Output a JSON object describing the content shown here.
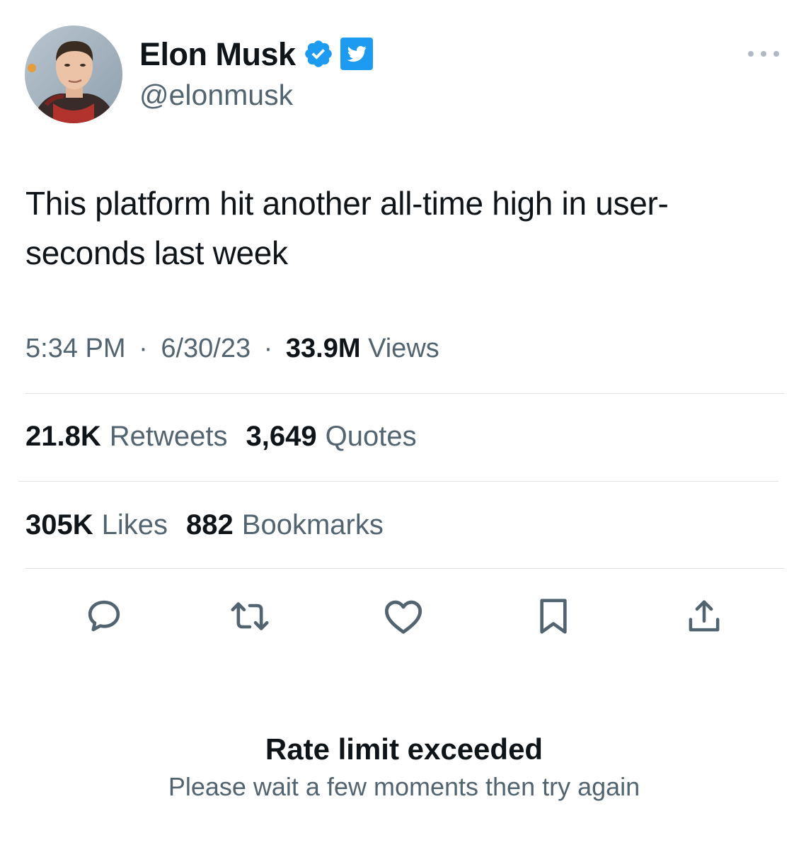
{
  "author": {
    "display_name": "Elon Musk",
    "handle": "@elonmusk",
    "avatar_icon": "profile-photo",
    "verified_icon": "verified-badge-icon",
    "affiliation_icon": "twitter-bird-badge-icon"
  },
  "tweet": {
    "text": "This platform hit another all-time high in user-seconds last week",
    "time": "5:34 PM",
    "separator": "·",
    "date": "6/30/23",
    "views_count": "33.9M",
    "views_label": "Views"
  },
  "stats": {
    "retweets_count": "21.8K",
    "retweets_label": "Retweets",
    "quotes_count": "3,649",
    "quotes_label": "Quotes",
    "likes_count": "305K",
    "likes_label": "Likes",
    "bookmarks_count": "882",
    "bookmarks_label": "Bookmarks"
  },
  "actions": [
    "reply-icon",
    "retweet-icon",
    "like-icon",
    "bookmark-icon",
    "share-icon"
  ],
  "error": {
    "title": "Rate limit exceeded",
    "message": "Please wait a few moments then try again"
  },
  "colors": {
    "text_primary": "#0f1419",
    "text_secondary": "#536471",
    "verified_blue": "#1d9bf0",
    "divider": "#dfe3e6"
  }
}
